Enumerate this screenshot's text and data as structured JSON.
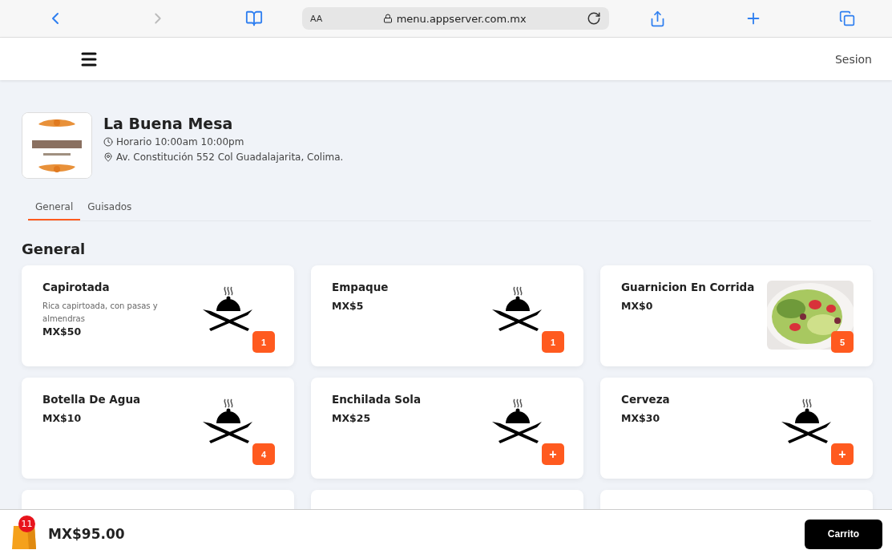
{
  "browser": {
    "text_size_label": "AA",
    "url": "menu.appserver.com.mx"
  },
  "navbar": {
    "session_link": "Sesion"
  },
  "restaurant": {
    "name": "La Buena Mesa",
    "hours": "Horario 10:00am 10:00pm",
    "address": "Av. Constitución 552 Col Guadalajarita, Colima."
  },
  "tabs": [
    {
      "label": "General",
      "selected": true
    },
    {
      "label": "Guisados",
      "selected": false
    }
  ],
  "section_title": "General",
  "items": [
    {
      "name": "Capirotada",
      "description": "Rica capirtoada, con pasas y almendras",
      "price": "MX$50",
      "kind": "icon",
      "badge": "1",
      "in_cart": true
    },
    {
      "name": "Empaque",
      "price": "MX$5",
      "kind": "icon",
      "badge": "1",
      "in_cart": true
    },
    {
      "name": "Guarnicion En Corrida",
      "price": "MX$0",
      "kind": "picture",
      "badge": "5",
      "in_cart": true
    },
    {
      "name": "Botella De Agua",
      "price": "MX$10",
      "kind": "icon",
      "badge": "4",
      "in_cart": true
    },
    {
      "name": "Enchilada Sola",
      "price": "MX$25",
      "kind": "icon",
      "badge": "+",
      "in_cart": false
    },
    {
      "name": "Cerveza",
      "price": "MX$30",
      "kind": "icon",
      "badge": "+",
      "in_cart": false
    },
    {
      "kind": "empty"
    },
    {
      "kind": "empty"
    },
    {
      "kind": "empty"
    }
  ],
  "cart": {
    "count": "11",
    "total": "MX$95.00",
    "button": "Carrito"
  }
}
